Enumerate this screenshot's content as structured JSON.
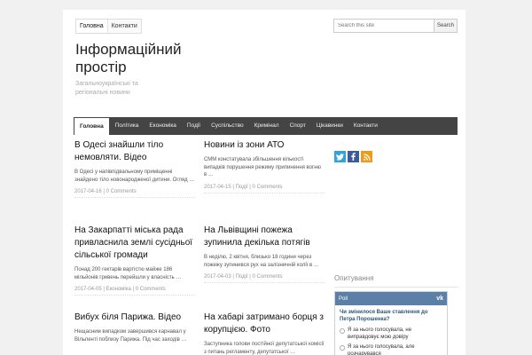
{
  "topmenu": {
    "items": [
      "Головна",
      "Контакти"
    ]
  },
  "search": {
    "placeholder": "Search this site",
    "button": "Search"
  },
  "site": {
    "title": "Інформаційний простір",
    "description": "Загальноукраїнські та регіональні новини"
  },
  "nav": {
    "items": [
      "Головна",
      "Політика",
      "Економіка",
      "Події",
      "Суспільство",
      "Кримінал",
      "Спорт",
      "Цікавинки",
      "Контакти"
    ]
  },
  "posts": [
    {
      "title": "В Одесі знайшли тіло немовляти. Відео",
      "excerpt": "В Одесі у напівпідвальному приміщенні знайдено тіло новонародженої дитини. Огляд …",
      "date": "2017-04-16",
      "category": "",
      "comments": "0 Comments"
    },
    {
      "title": "Новини із зони АТО",
      "excerpt": "СММ констатувала збільшення кількості випадків порушення режиму припинення вогню в …",
      "date": "2017-04-15",
      "category": "Події",
      "comments": "0 Comments"
    },
    {
      "title": "На Закарпатті міська рада привласнила землі сусідньої сільської громади",
      "excerpt": "Понад 200 гектарів вартістю майже 186 мільйонів гривень перейшли у власність …",
      "date": "2017-04-05",
      "category": "Економіка",
      "comments": "0 Comments"
    },
    {
      "title": "На Львівщині пожежа зупинила декілька потягів",
      "excerpt": "В неділю, 2 квітня, близько 18 години через пожежу зупинився рух на залізничній колії в …",
      "date": "2017-04-03",
      "category": "Події",
      "comments": "0 Comments"
    },
    {
      "title": "Вибух біля Парижа. Відео",
      "excerpt": "Нещасним випадком завершився карнавал у Вільпенті поблизу Парижа. Під час заходів …",
      "date": "",
      "category": "",
      "comments": ""
    },
    {
      "title": "На хабарі затримано борця з корупцією. Фото",
      "excerpt": "Заступника голови постійної депутатської комісії з питань регламенту, депутатської …",
      "date": "",
      "category": "",
      "comments": ""
    }
  ],
  "social": {
    "twitter": "t",
    "facebook": "f",
    "rss": "rss-icon"
  },
  "poll": {
    "section_title": "Опитування",
    "widget_label": "Poll",
    "question": "Чи змінилося Ваше ставлення до Петра Порошенка?",
    "options": [
      "Я за нього голосувала, не виправдовує мою довіру",
      "Я за нього голосувала, але розчарувався"
    ]
  },
  "colors": {
    "nav_bg": "#444444",
    "poll_head": "#5b7fa6",
    "twitter": "#2fa3dc",
    "facebook": "#3c5b9b",
    "rss": "#f09a1a"
  }
}
